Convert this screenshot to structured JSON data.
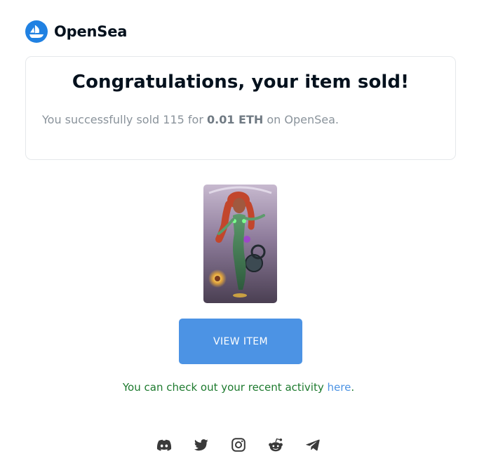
{
  "header": {
    "brand": "OpenSea",
    "logo_icon": "opensea-sailboat-icon"
  },
  "sale": {
    "title": "Congratulations, your item sold!",
    "message_prefix": "You successfully sold 115 for ",
    "price": "0.01 ETH",
    "message_suffix": " on OpenSea."
  },
  "item": {
    "image_description": "115"
  },
  "actions": {
    "view_item_label": "VIEW ITEM"
  },
  "activity": {
    "text": "You can check out your recent activity ",
    "link_text": "here",
    "trailing": "."
  },
  "social": [
    "discord-icon",
    "twitter-icon",
    "instagram-icon",
    "reddit-icon",
    "telegram-icon"
  ],
  "colors": {
    "brand_blue": "#2081e2",
    "button_blue": "#4c93e4",
    "activity_green": "#1d7a2e",
    "muted_text": "#8a939b"
  }
}
